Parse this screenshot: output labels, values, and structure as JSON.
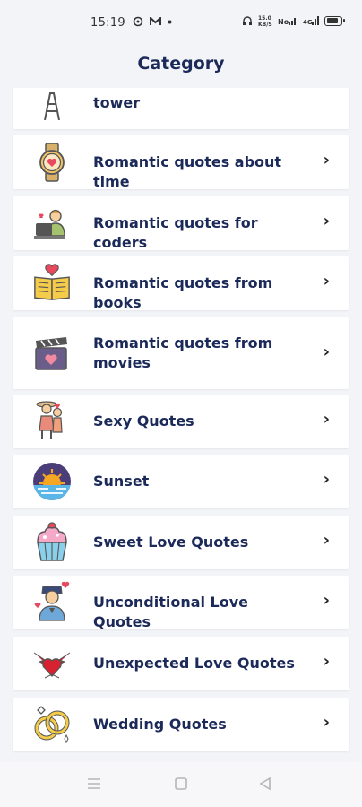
{
  "status_bar": {
    "time": "15:19",
    "left_icons": [
      "settings-circle-icon",
      "m-icon",
      "dot-icon"
    ],
    "right_icons": [
      "headphones-icon",
      "speed-text-icon",
      "signal-icon",
      "signal-icon-2",
      "battery-icon"
    ],
    "speed_text": "15.0\nKB/S"
  },
  "header": {
    "title": "Category"
  },
  "categories": [
    {
      "label": "tower",
      "icon": "tower-icon"
    },
    {
      "label": "Romantic quotes about time",
      "icon": "watch-icon"
    },
    {
      "label": "Romantic quotes for coders",
      "icon": "coder-icon"
    },
    {
      "label": "Romantic quotes from books",
      "icon": "book-icon"
    },
    {
      "label": "Romantic quotes from movies",
      "icon": "clapperboard-icon"
    },
    {
      "label": "Sexy Quotes",
      "icon": "couple-icon"
    },
    {
      "label": "Sunset",
      "icon": "sunset-icon"
    },
    {
      "label": "Sweet Love Quotes",
      "icon": "cupcake-icon"
    },
    {
      "label": "Unconditional Love Quotes",
      "icon": "person-heart-icon"
    },
    {
      "label": "Unexpected Love Quotes",
      "icon": "winged-heart-icon"
    },
    {
      "label": "Wedding Quotes",
      "icon": "rings-icon"
    }
  ],
  "chevron_glyph": "›",
  "nav_bar": {
    "buttons": [
      "menu-icon",
      "home-square-icon",
      "back-triangle-icon"
    ]
  }
}
